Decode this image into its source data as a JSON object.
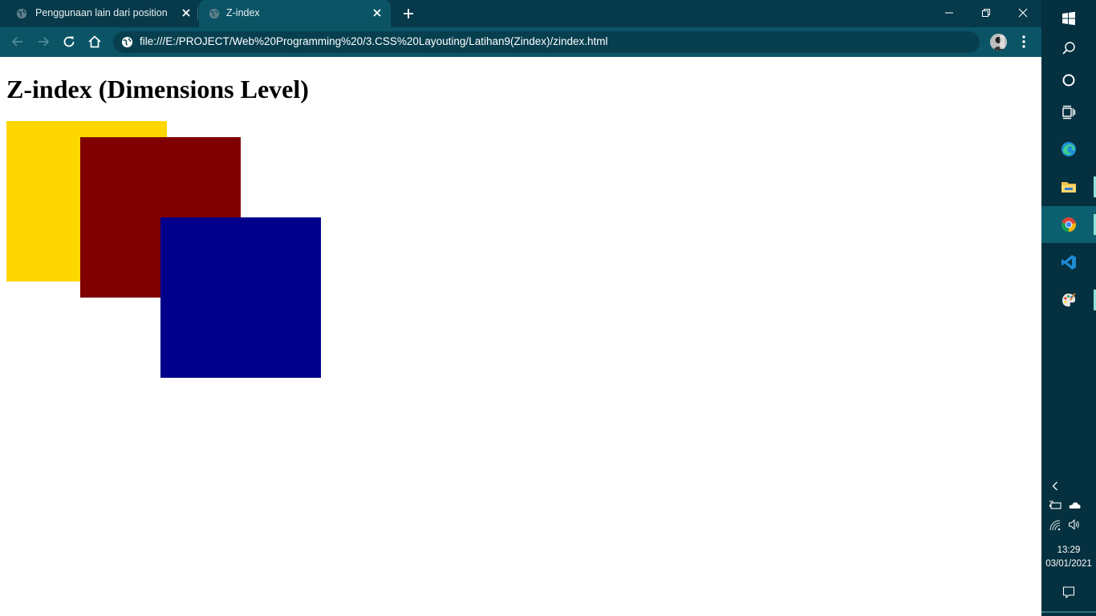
{
  "tabs": [
    {
      "title": "Penggunaan lain dari position",
      "active": false
    },
    {
      "title": "Z-index",
      "active": true
    }
  ],
  "address_bar": {
    "url": "file:///E:/PROJECT/Web%20Programming%20/3.CSS%20Layouting/Latihan9(Zindex)/zindex.html"
  },
  "page": {
    "heading": "Z-index (Dimensions Level)",
    "boxes": [
      {
        "name": "yellow",
        "color": "#ffd700"
      },
      {
        "name": "maroon",
        "color": "#800000"
      },
      {
        "name": "navy",
        "color": "#00008b"
      }
    ]
  },
  "colors": {
    "chrome_dark": "#06394a",
    "chrome_toolbar": "#0a5466",
    "taskbar": "#05303f",
    "taskbar_active": "#0b5f6f"
  },
  "taskbar": {
    "apps": [
      "windows-start",
      "search",
      "cortana",
      "task-view",
      "edge",
      "file-explorer",
      "chrome",
      "vscode",
      "paint"
    ],
    "tray": [
      "show-hidden-icons",
      "battery",
      "onedrive",
      "wifi",
      "volume"
    ],
    "clock": {
      "time": "13:29",
      "date": "03/01/2021"
    }
  }
}
